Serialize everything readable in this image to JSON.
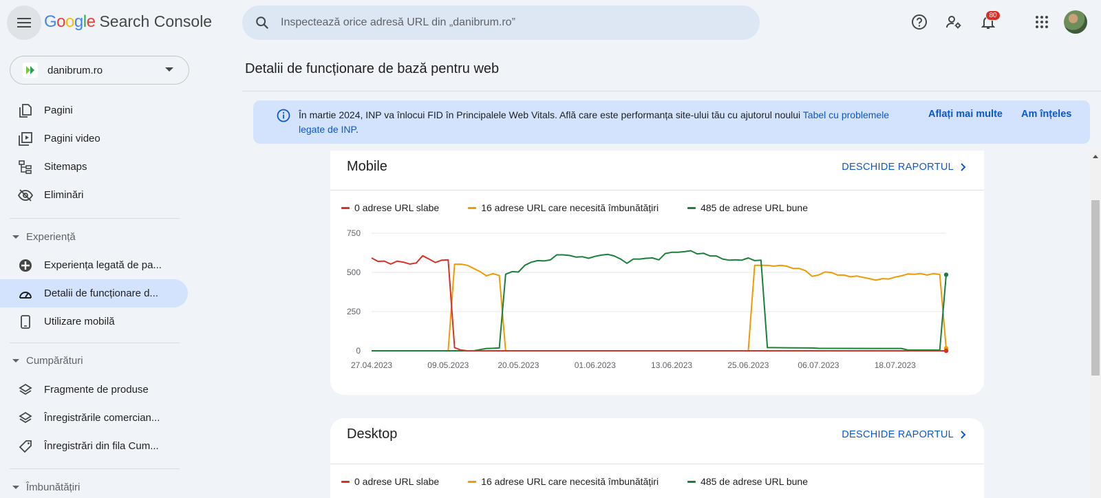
{
  "header": {
    "logo_letters": [
      {
        "ch": "G",
        "color": "#4285F4"
      },
      {
        "ch": "o",
        "color": "#EA4335"
      },
      {
        "ch": "o",
        "color": "#FBBC05"
      },
      {
        "ch": "g",
        "color": "#4285F4"
      },
      {
        "ch": "l",
        "color": "#34A853"
      },
      {
        "ch": "e",
        "color": "#EA4335"
      }
    ],
    "product_name": "Search Console",
    "search_placeholder": "Inspectează orice adresă URL din „danibrum.ro”",
    "notification_count": "80"
  },
  "sidebar": {
    "property": "danibrum.ro",
    "items": [
      {
        "label": "Pagini",
        "icon": "pages-icon"
      },
      {
        "label": "Pagini video",
        "icon": "video-pages-icon"
      },
      {
        "label": "Sitemaps",
        "icon": "sitemaps-icon"
      },
      {
        "label": "Eliminări",
        "icon": "removals-icon"
      }
    ],
    "sections": [
      {
        "title": "Experiență",
        "items": [
          {
            "label": "Experiența legată de pa...",
            "icon": "page-experience-icon"
          },
          {
            "label": "Detalii de funcționare d...",
            "icon": "speedometer-icon",
            "active": true
          },
          {
            "label": "Utilizare mobilă",
            "icon": "mobile-icon"
          }
        ]
      },
      {
        "title": "Cumpărături",
        "items": [
          {
            "label": "Fragmente de produse",
            "icon": "layers-icon"
          },
          {
            "label": "Înregistrările comercian...",
            "icon": "layers-icon"
          },
          {
            "label": "Înregistrări din fila Cum...",
            "icon": "tag-icon"
          }
        ]
      },
      {
        "title": "Îmbunătățiri",
        "items": []
      }
    ]
  },
  "main": {
    "title": "Detalii de funcționare de bază pentru web",
    "banner": {
      "text": "În martie 2024, INP va înlocui FID în Principalele Web Vitals. Află care este performanța site-ului tău cu ajutorul noului ",
      "link": "Tabel cu problemele legate de INP",
      "suffix": ".",
      "learn_more": "Aflați mai multe",
      "dismiss": "Am înțeles"
    },
    "cards": [
      {
        "title": "Mobile",
        "link": "DESCHIDE RAPORTUL"
      },
      {
        "title": "Desktop",
        "link": "DESCHIDE RAPORTUL"
      }
    ],
    "legend": [
      {
        "label": "0 adrese URL slabe",
        "color": "#d93025"
      },
      {
        "label": "16 adrese URL care necesită îmbunătățiri",
        "color": "#f29900"
      },
      {
        "label": "485 de adrese URL bune",
        "color": "#188038"
      }
    ]
  },
  "chart_data": {
    "type": "line",
    "title": "Mobile",
    "x_tick_labels": [
      "27.04.2023",
      "09.05.2023",
      "20.05.2023",
      "01.06.2023",
      "13.06.2023",
      "25.06.2023",
      "06.07.2023",
      "18.07.2023"
    ],
    "x_start": "2023-04-27",
    "x_end": "2023-07-26",
    "ylim": [
      0,
      750
    ],
    "y_ticks": [
      0,
      250,
      500,
      750
    ],
    "grid": true,
    "legend_position": "top-left",
    "series": [
      {
        "name": "0 adrese URL slabe",
        "color": "#d93025",
        "points": [
          [
            "2023-04-27",
            592
          ],
          [
            "2023-04-28",
            570
          ],
          [
            "2023-04-29",
            572
          ],
          [
            "2023-04-30",
            553
          ],
          [
            "2023-05-01",
            572
          ],
          [
            "2023-05-02",
            565
          ],
          [
            "2023-05-03",
            553
          ],
          [
            "2023-05-04",
            560
          ],
          [
            "2023-05-05",
            606
          ],
          [
            "2023-05-06",
            585
          ],
          [
            "2023-05-07",
            563
          ],
          [
            "2023-05-08",
            578
          ],
          [
            "2023-05-09",
            580
          ],
          [
            "2023-05-10",
            20
          ],
          [
            "2023-05-11",
            5
          ],
          [
            "2023-05-12",
            0
          ],
          [
            "2023-05-13",
            0
          ],
          [
            "2023-05-14",
            0
          ],
          [
            "2023-07-26",
            0
          ]
        ]
      },
      {
        "name": "16 adrese URL care necesită îmbunătățiri",
        "color": "#f29900",
        "points": [
          [
            "2023-04-27",
            0
          ],
          [
            "2023-05-09",
            0
          ],
          [
            "2023-05-10",
            552
          ],
          [
            "2023-05-11",
            552
          ],
          [
            "2023-05-12",
            545
          ],
          [
            "2023-05-13",
            525
          ],
          [
            "2023-05-14",
            505
          ],
          [
            "2023-05-15",
            478
          ],
          [
            "2023-05-16",
            492
          ],
          [
            "2023-05-17",
            480
          ],
          [
            "2023-05-18",
            0
          ],
          [
            "2023-05-19",
            0
          ],
          [
            "2023-06-25",
            0
          ],
          [
            "2023-06-26",
            545
          ],
          [
            "2023-06-27",
            545
          ],
          [
            "2023-06-28",
            545
          ],
          [
            "2023-06-29",
            540
          ],
          [
            "2023-06-30",
            545
          ],
          [
            "2023-07-01",
            540
          ],
          [
            "2023-07-02",
            525
          ],
          [
            "2023-07-03",
            525
          ],
          [
            "2023-07-04",
            510
          ],
          [
            "2023-07-05",
            475
          ],
          [
            "2023-07-06",
            483
          ],
          [
            "2023-07-07",
            502
          ],
          [
            "2023-07-08",
            500
          ],
          [
            "2023-07-09",
            483
          ],
          [
            "2023-07-10",
            483
          ],
          [
            "2023-07-11",
            472
          ],
          [
            "2023-07-12",
            477
          ],
          [
            "2023-07-13",
            468
          ],
          [
            "2023-07-14",
            460
          ],
          [
            "2023-07-15",
            450
          ],
          [
            "2023-07-16",
            460
          ],
          [
            "2023-07-17",
            458
          ],
          [
            "2023-07-18",
            470
          ],
          [
            "2023-07-19",
            478
          ],
          [
            "2023-07-20",
            490
          ],
          [
            "2023-07-21",
            488
          ],
          [
            "2023-07-22",
            492
          ],
          [
            "2023-07-23",
            483
          ],
          [
            "2023-07-24",
            492
          ],
          [
            "2023-07-25",
            487
          ],
          [
            "2023-07-26",
            16
          ]
        ]
      },
      {
        "name": "485 de adrese URL bune",
        "color": "#188038",
        "points": [
          [
            "2023-04-27",
            0
          ],
          [
            "2023-05-12",
            0
          ],
          [
            "2023-05-13",
            0
          ],
          [
            "2023-05-14",
            8
          ],
          [
            "2023-05-15",
            15
          ],
          [
            "2023-05-16",
            16
          ],
          [
            "2023-05-17",
            18
          ],
          [
            "2023-05-18",
            488
          ],
          [
            "2023-05-19",
            505
          ],
          [
            "2023-05-20",
            502
          ],
          [
            "2023-05-21",
            545
          ],
          [
            "2023-05-22",
            565
          ],
          [
            "2023-05-23",
            575
          ],
          [
            "2023-05-24",
            573
          ],
          [
            "2023-05-25",
            580
          ],
          [
            "2023-05-26",
            612
          ],
          [
            "2023-05-27",
            612
          ],
          [
            "2023-05-28",
            608
          ],
          [
            "2023-05-29",
            598
          ],
          [
            "2023-05-30",
            600
          ],
          [
            "2023-05-31",
            590
          ],
          [
            "2023-06-01",
            602
          ],
          [
            "2023-06-02",
            610
          ],
          [
            "2023-06-03",
            615
          ],
          [
            "2023-06-04",
            605
          ],
          [
            "2023-06-05",
            585
          ],
          [
            "2023-06-06",
            558
          ],
          [
            "2023-06-07",
            585
          ],
          [
            "2023-06-08",
            585
          ],
          [
            "2023-06-09",
            590
          ],
          [
            "2023-06-10",
            592
          ],
          [
            "2023-06-11",
            580
          ],
          [
            "2023-06-12",
            620
          ],
          [
            "2023-06-13",
            628
          ],
          [
            "2023-06-14",
            628
          ],
          [
            "2023-06-15",
            632
          ],
          [
            "2023-06-16",
            638
          ],
          [
            "2023-06-17",
            618
          ],
          [
            "2023-06-18",
            622
          ],
          [
            "2023-06-19",
            605
          ],
          [
            "2023-06-20",
            605
          ],
          [
            "2023-06-21",
            585
          ],
          [
            "2023-06-22",
            578
          ],
          [
            "2023-06-23",
            580
          ],
          [
            "2023-06-24",
            578
          ],
          [
            "2023-06-25",
            592
          ],
          [
            "2023-06-26",
            575
          ],
          [
            "2023-06-27",
            578
          ],
          [
            "2023-06-28",
            20
          ],
          [
            "2023-06-29",
            20
          ],
          [
            "2023-07-05",
            18
          ],
          [
            "2023-07-06",
            16
          ],
          [
            "2023-07-15",
            15
          ],
          [
            "2023-07-19",
            15
          ],
          [
            "2023-07-20",
            5
          ],
          [
            "2023-07-24",
            5
          ],
          [
            "2023-07-25",
            5
          ],
          [
            "2023-07-26",
            485
          ]
        ]
      }
    ]
  }
}
